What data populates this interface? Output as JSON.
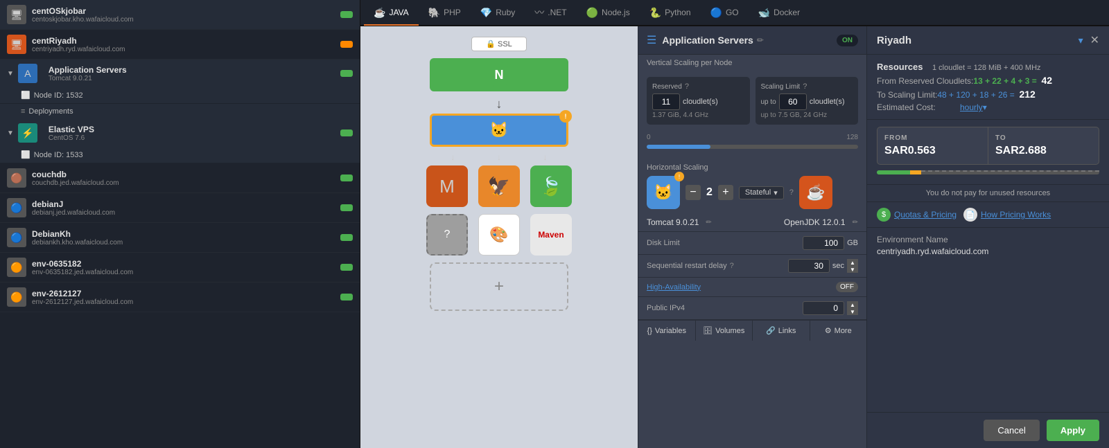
{
  "sidebar": {
    "items": [
      {
        "name": "centOSkjobar",
        "domain": "centoskjobar.kho.wafaicloud.com",
        "icon": "🖥",
        "badge_color": "green"
      },
      {
        "name": "centRiyadh",
        "domain": "centriyadh.ryd.wafaicloud.com",
        "icon": "🖥",
        "badge_color": "orange"
      },
      {
        "name": "Application Servers",
        "sublabel": "Tomcat 9.0.21",
        "icon": "🅰",
        "badge_color": "green",
        "is_group": true,
        "children": [
          {
            "label": "Node ID: 1532"
          },
          {
            "label": "Deployments"
          }
        ]
      },
      {
        "name": "Elastic VPS",
        "sublabel": "CentOS 7.6",
        "icon": "⚡",
        "badge_color": "green",
        "is_group": true,
        "children": [
          {
            "label": "Node ID: 1533"
          }
        ]
      },
      {
        "name": "couchdb",
        "domain": "couchdb.jed.wafaicloud.com",
        "icon": "🟠",
        "badge_color": "green"
      },
      {
        "name": "debianJ",
        "domain": "debianj.jed.wafaicloud.com",
        "icon": "🟠",
        "badge_color": "green"
      },
      {
        "name": "DebianKh",
        "domain": "debiankh.kho.wafaicloud.com",
        "icon": "🟠",
        "badge_color": "green"
      },
      {
        "name": "env-0635182",
        "domain": "env-0635182.jed.wafaicloud.com",
        "icon": "🟠",
        "badge_color": "green"
      },
      {
        "name": "env-2612127",
        "domain": "env-2612127.jed.wafaicloud.com",
        "icon": "🟠",
        "badge_color": "green"
      }
    ]
  },
  "tabs": [
    {
      "label": "JAVA",
      "icon": "☕",
      "active": true
    },
    {
      "label": "PHP",
      "icon": "🐘"
    },
    {
      "label": "Ruby",
      "icon": "💎"
    },
    {
      "label": ".NET",
      "icon": "〰"
    },
    {
      "label": "Node.js",
      "icon": "🟢"
    },
    {
      "label": "Python",
      "icon": "🐍"
    },
    {
      "label": "GO",
      "icon": "🔵"
    },
    {
      "label": "Docker",
      "icon": "🐋"
    }
  ],
  "topology": {
    "ssl_label": "SSL",
    "nginx_icon": "N",
    "tomcat_icon": "🐱",
    "node_badge": "!",
    "nodes": [
      "M",
      "🦅",
      "🍃"
    ],
    "add_nodes": [
      "?",
      "🎨",
      "Maven"
    ]
  },
  "config_panel": {
    "title": "Application Servers",
    "toggle_label": "ON",
    "scaling_title": "Vertical Scaling per Node",
    "reserved_label": "Reserved",
    "reserved_value": "11",
    "reserved_unit": "cloudlet(s)",
    "reserved_sub": "1.37 GiB, 4.4 GHz",
    "scaling_limit_label": "Scaling Limit",
    "scaling_limit_up_to": "up to",
    "scaling_limit_value": "60",
    "scaling_limit_unit": "cloudlet(s)",
    "scaling_limit_sub": "up to 7.5 GB, 24 GHz",
    "slider_min": "0",
    "slider_max": "128",
    "horiz_label": "Horizontal Scaling",
    "node_count": "2",
    "stateful_label": "Stateful",
    "tomcat_label": "Tomcat 9.0.21",
    "openjdk_label": "OpenJDK 12.0.1",
    "disk_limit_label": "Disk Limit",
    "disk_limit_value": "100",
    "disk_limit_unit": "GB",
    "seq_restart_label": "Sequential restart delay",
    "seq_restart_value": "30",
    "seq_restart_unit": "sec",
    "ha_label": "High-Availability",
    "ha_value": "OFF",
    "ipv4_label": "Public IPv4",
    "ipv4_value": "0",
    "tabs": [
      "Variables",
      "Volumes",
      "Links",
      "More"
    ]
  },
  "far_right": {
    "title": "Riyadh",
    "resources_label": "Resources",
    "cloudlet_def": "1 cloudlet = 128 MiB + 400 MHz",
    "from_reserved_label": "From Reserved Cloudlets:",
    "from_reserved_math": "13 + 22 + 4 + 3 =",
    "from_reserved_total": "42",
    "to_scaling_label": "To Scaling Limit:",
    "to_scaling_math": "48 + 120 + 18 + 26 =",
    "to_scaling_total": "212",
    "est_cost_label": "Estimated Cost:",
    "est_cost_period": "hourly",
    "from_price_label": "FROM",
    "from_price_value": "SAR0.563",
    "to_price_label": "TO",
    "to_price_value": "SAR2.688",
    "unused_note": "You do not pay for unused resources",
    "quotas_label": "Quotas & Pricing",
    "how_pricing_label": "How Pricing Works",
    "env_name_label": "Environment Name",
    "env_name_value": "centriyadh.ryd.wafaicloud.com",
    "cancel_label": "Cancel",
    "apply_label": "Apply"
  }
}
